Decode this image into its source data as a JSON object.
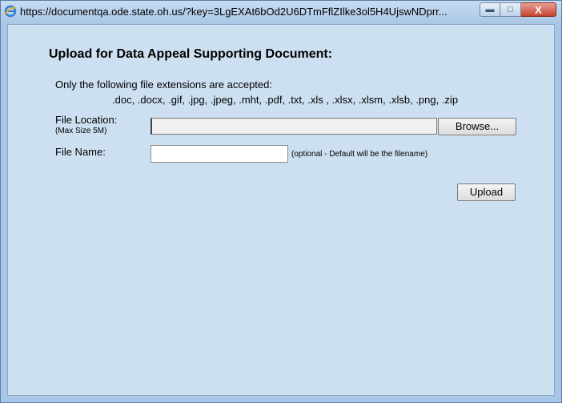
{
  "window": {
    "url": "https://documentqa.ode.state.oh.us/?key=3LgEXAt6bOd2U6DTmFflZIlke3ol5H4UjswNDprr...",
    "minimize_icon": "minimize-icon",
    "maximize_icon": "maximize-icon",
    "close_glyph": "X",
    "browser_icon": "internet-explorer-icon"
  },
  "form": {
    "title": "Upload for Data Appeal Supporting Document:",
    "extensions_intro": "Only the following file extensions are accepted:",
    "extensions_list": ".doc, .docx, .gif, .jpg, .jpeg, .mht, .pdf, .txt, .xls , .xlsx, .xlsm, .xlsb, .png, .zip",
    "file_location_label": "File Location:",
    "file_location_sublabel": "(Max Size 5M)",
    "file_location_value": "",
    "browse_label": "Browse...",
    "file_name_label": "File Name:",
    "file_name_value": "",
    "file_name_hint": "(optional - Default will be the filename)",
    "upload_label": "Upload"
  },
  "colors": {
    "window_frame": "#a9c6e6",
    "content_bg": "#cde0f1",
    "close_button": "#c7432f"
  }
}
